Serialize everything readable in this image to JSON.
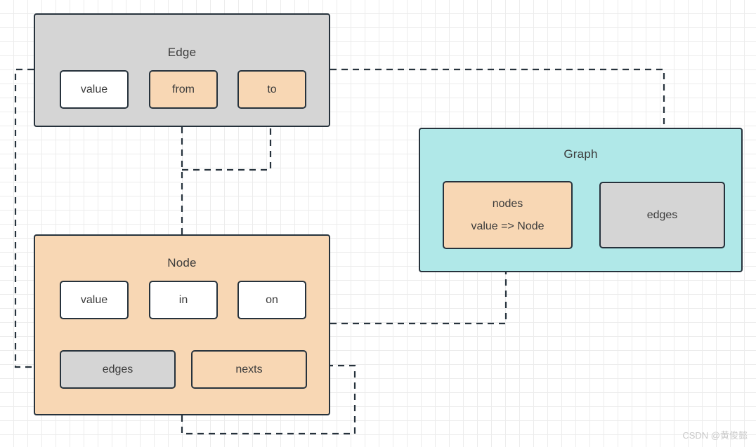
{
  "diagram": {
    "title_edge": "Edge",
    "title_node": "Node",
    "title_graph": "Graph",
    "colors": {
      "gray": "#d5d5d5",
      "orange": "#f8d7b4",
      "teal": "#b0e8e8",
      "white": "#ffffff",
      "stroke": "#26323c",
      "grid": "#ececec",
      "text": "#3b3b3b",
      "watermark": "#c9c9c9"
    },
    "edge": {
      "title": "Edge",
      "fields": [
        {
          "label": "value",
          "fill": "white"
        },
        {
          "label": "from",
          "fill": "orange"
        },
        {
          "label": "to",
          "fill": "orange"
        }
      ]
    },
    "node": {
      "title": "Node",
      "fields_row1": [
        {
          "label": "value",
          "fill": "white"
        },
        {
          "label": "in",
          "fill": "white"
        },
        {
          "label": "on",
          "fill": "white"
        }
      ],
      "fields_row2": [
        {
          "label": "edges",
          "fill": "gray"
        },
        {
          "label": "nexts",
          "fill": "orange"
        }
      ]
    },
    "graph": {
      "title": "Graph",
      "fields": [
        {
          "label": "nodes",
          "sublabel": "value => Node",
          "fill": "orange"
        },
        {
          "label": "edges",
          "sublabel": "",
          "fill": "gray"
        }
      ]
    },
    "connections": [
      {
        "name": "edge-to-node-edges",
        "from": "Edge",
        "to": "Node.edges",
        "style": "dashed",
        "arrow": "right"
      },
      {
        "name": "edge-to-graph-edges",
        "from": "Edge",
        "to": "Graph.edges",
        "style": "dashed",
        "arrow": "down"
      },
      {
        "name": "node-to-edge-from",
        "from": "Node",
        "to": "Edge.from",
        "style": "dashed",
        "arrow": "up"
      },
      {
        "name": "node-to-edge-to",
        "from": "Node",
        "to": "Edge.to",
        "style": "dashed",
        "arrow": "up"
      },
      {
        "name": "node-to-graph-nodes",
        "from": "Node",
        "to": "Graph.nodes",
        "style": "dashed",
        "arrow": "up"
      },
      {
        "name": "node-to-node-nexts",
        "from": "Node",
        "to": "Node.nexts",
        "style": "dashed",
        "arrow": "left"
      }
    ]
  },
  "watermark": {
    "text": "CSDN @黄俊懿"
  }
}
